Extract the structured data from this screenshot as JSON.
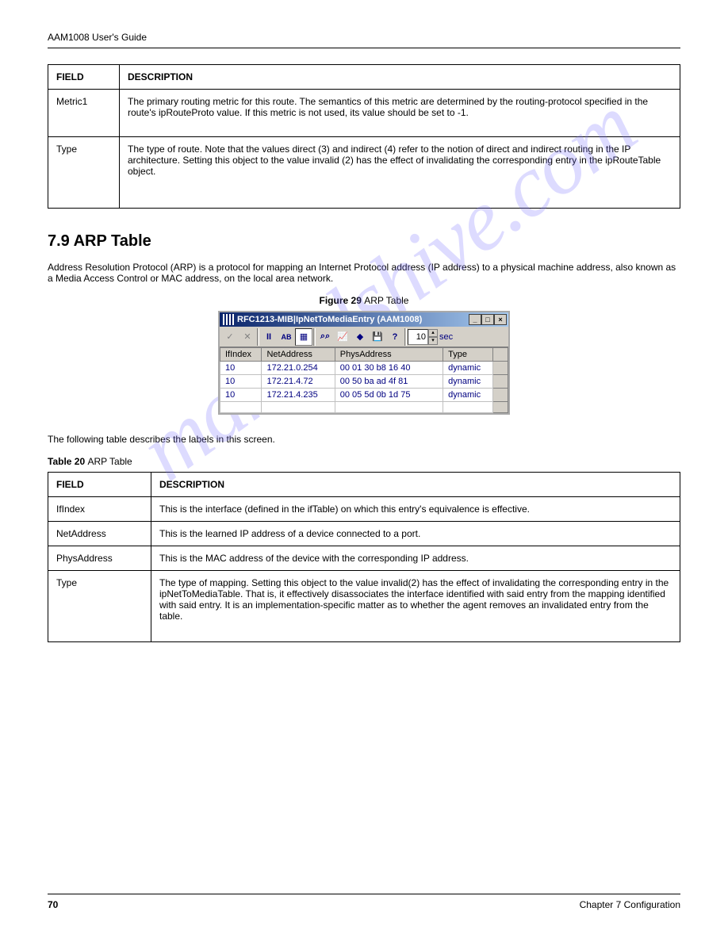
{
  "header": {
    "left": "AAM1008 User's Guide",
    "right": ""
  },
  "table1": {
    "headers": [
      "FIELD",
      "DESCRIPTION"
    ],
    "rows": [
      {
        "field": "Metric1",
        "desc": "The primary routing metric for this route. The semantics of this metric are determined by the routing-protocol specified in the route's ipRouteProto value.  If this metric is not used, its value should be set to -1.",
        "heightClass": "cell-high"
      },
      {
        "field": "Type",
        "desc": "The type of route. Note that the values direct (3) and indirect (4) refer to the notion of direct and indirect routing in the IP architecture. Setting this object to the value invalid (2) has the effect of invalidating the corresponding entry in the ipRouteTable object.",
        "heightClass": "cell-higher"
      }
    ]
  },
  "sectionTitle": "7.9  ARP Table",
  "sectionPara": "Address Resolution Protocol (ARP) is a protocol for mapping an Internet Protocol address (IP address) to a physical machine address, also known as a Media Access Control or MAC address, on the local area network.",
  "figCaption": {
    "prefix": "Figure 29 ",
    "text": "ARP Table"
  },
  "dialog": {
    "title": "RFC1213-MIB|IpNetToMediaEntry (AAM1008)",
    "secInputValue": "10",
    "secLabel": "sec",
    "columns": [
      "IfIndex",
      "NetAddress",
      "PhysAddress",
      "Type",
      ""
    ],
    "rows": [
      [
        "10",
        "172.21.0.254",
        "00 01 30 b8 16 40",
        "dynamic",
        ""
      ],
      [
        "10",
        "172.21.4.72",
        "00 50 ba ad 4f 81",
        "dynamic",
        ""
      ],
      [
        "10",
        "172.21.4.235",
        "00 05 5d 0b 1d 75",
        "dynamic",
        ""
      ],
      [
        "",
        "",
        "",
        "",
        ""
      ]
    ]
  },
  "paraMiddle": "The following table describes the labels in this screen.",
  "table2Caption": {
    "prefix": "Table 20 ",
    "text": "ARP Table"
  },
  "table2": {
    "headers": [
      "FIELD",
      "DESCRIPTION"
    ],
    "rows": [
      {
        "field": "IfIndex",
        "desc": "This is the interface (defined in the ifTable) on which this entry's equivalence is effective.",
        "heightClass": "cell-high"
      },
      {
        "field": "NetAddress",
        "desc": "This is the learned IP address of a device connected to a port.",
        "heightClass": ""
      },
      {
        "field": "PhysAddress",
        "desc": "This is the MAC address of the device with the corresponding IP address.",
        "heightClass": ""
      },
      {
        "field": "Type",
        "desc": "The type of mapping. Setting this object to the value invalid(2) has the effect of invalidating the corresponding entry in the ipNetToMediaTable.  That is, it effectively disassociates the interface identified with said entry from the mapping identified with said entry. It is an implementation-specific matter as to whether the agent removes an invalidated entry from the table.",
        "heightClass": "cell-higher"
      }
    ]
  },
  "footer": {
    "left": "70",
    "right": "Chapter 7 Configuration"
  },
  "watermark": "manualshive.com"
}
